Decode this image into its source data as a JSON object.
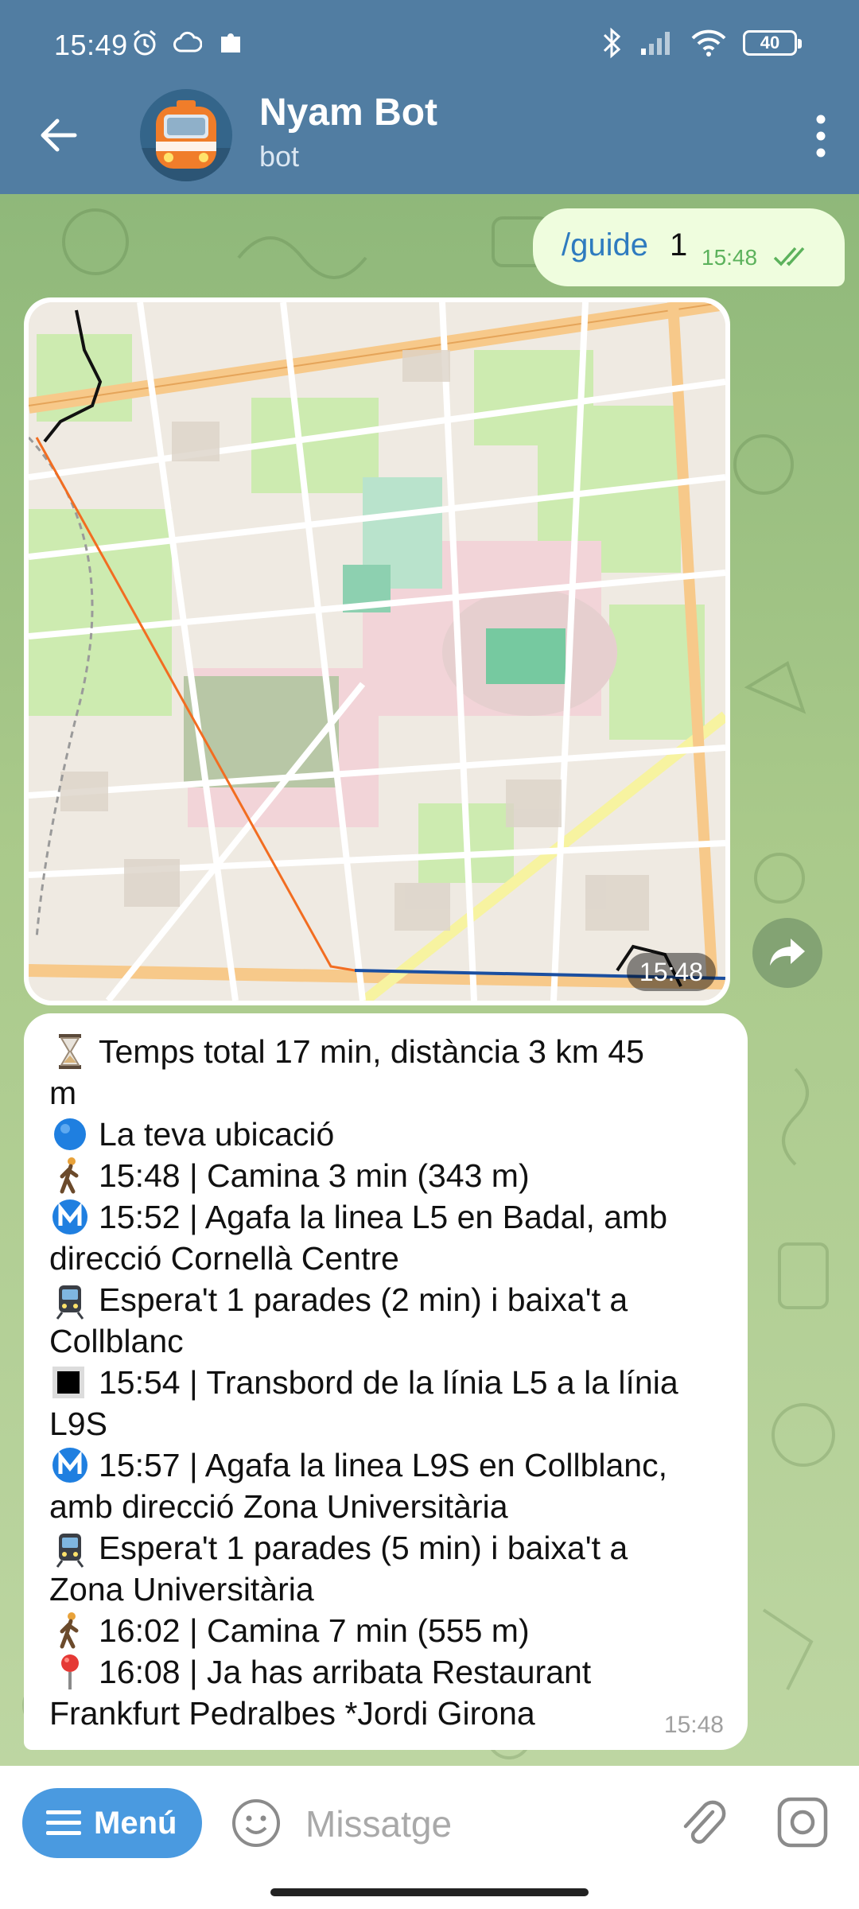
{
  "status_bar": {
    "time": "15:49",
    "battery": "40",
    "left_icons": [
      "alarm-icon",
      "cloud-icon",
      "puzzle-icon"
    ],
    "right_icons": [
      "bluetooth-icon",
      "signal-icon",
      "wifi-icon",
      "battery-icon"
    ]
  },
  "header": {
    "title": "Nyam Bot",
    "subtitle": "bot",
    "back_icon": "back-arrow-icon",
    "more_icon": "more-vertical-icon",
    "bg_color": "#517da2"
  },
  "chat": {
    "outgoing": {
      "command": "/guide",
      "argument": "1",
      "time": "15:48",
      "status_icon": "double-check-icon"
    },
    "map_message": {
      "time": "15:48",
      "forward_icon": "forward-icon"
    },
    "route_message": {
      "time": "15:48",
      "lines": [
        {
          "icon": "hourglass-icon",
          "text": "Temps total 17 min, distància 3 km 45"
        },
        {
          "icon": "",
          "text": "m"
        },
        {
          "icon": "blue-circle-icon",
          "text": "La teva ubicació"
        },
        {
          "icon": "walking-person-icon",
          "text": "15:48 | Camina 3 min (343 m)"
        },
        {
          "icon": "metro-icon",
          "text": "15:52 | Agafa la linea L5 en Badal, amb"
        },
        {
          "icon": "",
          "text": "direcció Cornellà Centre"
        },
        {
          "icon": "tram-icon",
          "text": "Espera't 1 parades (2 min) i baixa't a"
        },
        {
          "icon": "",
          "text": "Collblanc"
        },
        {
          "icon": "black-square-icon",
          "text": "15:54 | Transbord de la línia L5 a la línia"
        },
        {
          "icon": "",
          "text": "L9S"
        },
        {
          "icon": "metro-icon",
          "text": "15:57 | Agafa la linea L9S en Collblanc,"
        },
        {
          "icon": "",
          "text": "amb direcció Zona Universitària"
        },
        {
          "icon": "tram-icon",
          "text": "Espera't 1 parades (5 min) i baixa't a"
        },
        {
          "icon": "",
          "text": "Zona Universitària"
        },
        {
          "icon": "walking-person-icon",
          "text": "16:02 | Camina 7 min (555 m)"
        },
        {
          "icon": "pin-icon",
          "text": "16:08 | Ja has arribata Restaurant"
        },
        {
          "icon": "",
          "text": "Frankfurt Pedralbes *Jordi Girona"
        }
      ]
    }
  },
  "input_bar": {
    "menu_label": "Menú",
    "placeholder": "Missatge",
    "accent_color": "#4a9ae0"
  }
}
